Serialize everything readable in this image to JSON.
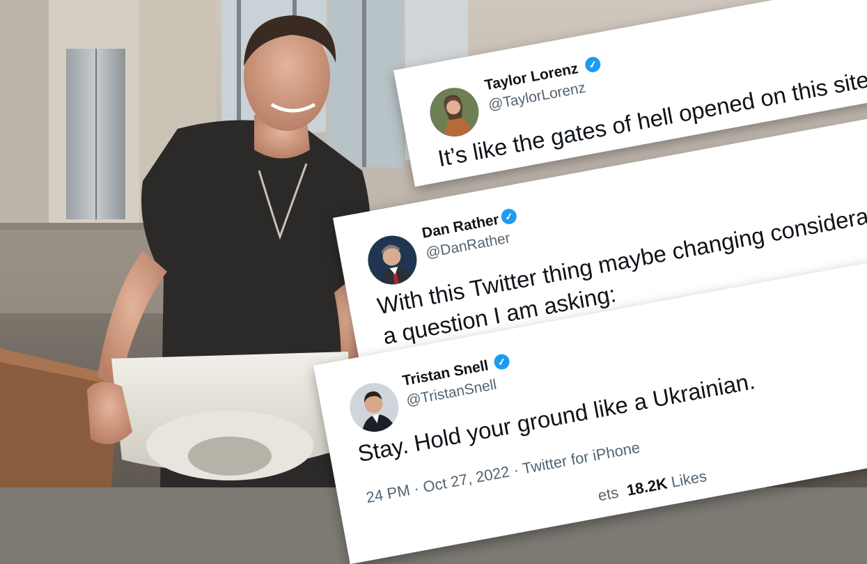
{
  "tweets": [
    {
      "name": "Taylor Lorenz",
      "handle": "@TaylorLorenz",
      "text": "It’s like the gates of hell opened on this site"
    },
    {
      "name": "Dan Rather",
      "handle": "@DanRather",
      "text_line1": "With this Twitter thing maybe changing considera",
      "text_line2": "a question I am asking:"
    },
    {
      "name": "Tristan Snell",
      "handle": "@TristanSnell",
      "text": "Stay. Hold your ground like a Ukrainian.",
      "meta": "24 PM · Oct 27, 2022 · Twitter for iPhone",
      "stats_partial": "ets",
      "likes_count": "18.2K",
      "likes_label": "Likes"
    }
  ],
  "colors": {
    "verified": "#1d9bf0",
    "name": "#0f1419",
    "handle": "#536471"
  },
  "icons": [
    "verified-badge-icon"
  ]
}
